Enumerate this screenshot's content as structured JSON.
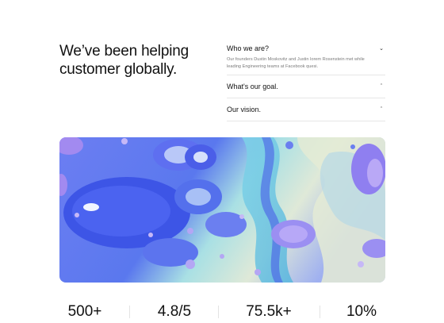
{
  "headline": {
    "line1": "We’ve been helping",
    "line2": "customer globally."
  },
  "accordion": {
    "items": [
      {
        "title": "Who we are?",
        "state": "open",
        "chevron": "chevron-down-icon",
        "body_line1": "Our founders Dustin Moskovitz and Justin lorem Rosenstein met while",
        "body_line2": "leading Engineering teams at Facebook quesi."
      },
      {
        "title": "What's our goal.",
        "state": "closed",
        "chevron": "chevron-up-icon"
      },
      {
        "title": "Our vision.",
        "state": "closed",
        "chevron": "chevron-up-icon"
      }
    ]
  },
  "image": {
    "subject": "abstract blue and purple fluid art"
  },
  "stats": [
    "500+",
    "4.8/5",
    "75.5k+",
    "10%"
  ],
  "colors": {
    "text": "#111111",
    "muted": "#7b7b7b",
    "divider": "#e6e6e6",
    "accent_blue": "#4f68f0",
    "accent_purple": "#a58cf5"
  }
}
